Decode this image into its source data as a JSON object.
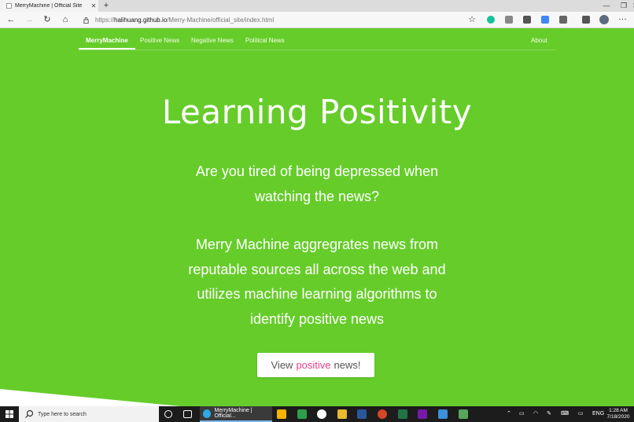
{
  "browser": {
    "tab_title": "MerryMachine | Official Site",
    "tab_close": "✕",
    "new_tab": "+",
    "window_controls": {
      "minimize": "—",
      "restore": "❐",
      "close": "✕"
    },
    "nav": {
      "back": "←",
      "forward": "→",
      "refresh": "↻",
      "home": "⌂"
    },
    "url_prefix": "https://",
    "url_host": "halihuang.github.io",
    "url_path": "/Merry-Machine/official_site/index.html",
    "favorite_icon": "☆",
    "extensions": [
      {
        "name": "grammarly-icon",
        "color": "#15c39a"
      },
      {
        "name": "gmail-icon",
        "color": "#888888"
      },
      {
        "name": "opt-icon",
        "color": "#555555"
      },
      {
        "name": "drive-icon",
        "color": "#4285f4"
      },
      {
        "name": "pen-icon",
        "color": "#666666"
      },
      {
        "name": "share-icon",
        "color": "#555555"
      }
    ],
    "menu": "…"
  },
  "site": {
    "brand": "MerryMachine",
    "nav_items": [
      "Positive News",
      "Negative News",
      "Political News"
    ],
    "about": "About",
    "title": "Learning Positivity",
    "tagline_lines": [
      "Are you tired of being depressed when",
      "watching the news?"
    ],
    "description_lines": [
      "Merry Machine aggregrates news from",
      "reputable sources all across the web and",
      "utilizes machine learning algorithms to",
      "identify positive news"
    ],
    "cta": {
      "before": "View",
      "accent": "positive",
      "after": "news!"
    },
    "colors": {
      "background": "#66cc2a",
      "accent": "#e83e8c"
    }
  },
  "taskbar": {
    "search_placeholder": "Type here to search",
    "active_app": "MerryMachine | Official...",
    "language": "ENG",
    "time": "1:28 AM",
    "date": "7/18/2020"
  }
}
